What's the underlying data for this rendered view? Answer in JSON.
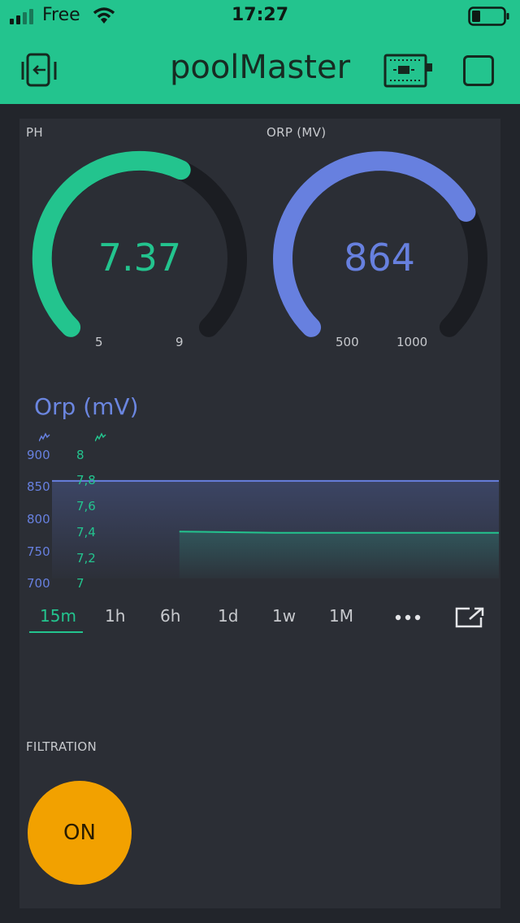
{
  "status_bar": {
    "carrier": "Free",
    "time": "17:27"
  },
  "header": {
    "title": "poolMaster",
    "icons": [
      "back-icon",
      "device-icon",
      "square-icon"
    ]
  },
  "gauges": [
    {
      "label": "PH",
      "value": "7.37",
      "min_label": "5",
      "max_label": "9",
      "min": 5,
      "max": 9,
      "reading": 7.37,
      "color": "#23c48e"
    },
    {
      "label": "ORP (MV)",
      "value": "864",
      "min_label": "500",
      "max_label": "1000",
      "min": 500,
      "max": 1000,
      "reading": 864,
      "color": "#6780df"
    }
  ],
  "chart": {
    "title": "Orp (mV)",
    "left_axis_ticks": [
      "900",
      "850",
      "800",
      "750",
      "700"
    ],
    "right_axis_ticks": [
      "8",
      "7,8",
      "7,6",
      "7,4",
      "7,2",
      "7"
    ],
    "tabs": [
      "15m",
      "1h",
      "6h",
      "1d",
      "1w",
      "1M"
    ],
    "active_tab": "15m"
  },
  "chart_data": {
    "type": "line",
    "series": [
      {
        "name": "Orp (mV)",
        "axis": "left",
        "ylim": [
          700,
          900
        ],
        "x_fraction": [
          0,
          1
        ],
        "values": [
          858,
          858
        ],
        "color": "#6780df"
      },
      {
        "name": "",
        "axis": "right",
        "ylim": [
          7,
          8
        ],
        "x_fraction": [
          0.285,
          0.5,
          1
        ],
        "values": [
          7.38,
          7.37,
          7.37
        ],
        "color": "#23c48e"
      }
    ]
  },
  "filtration": {
    "label": "FILTRATION",
    "button": "ON",
    "button_color": "#f2a100"
  }
}
